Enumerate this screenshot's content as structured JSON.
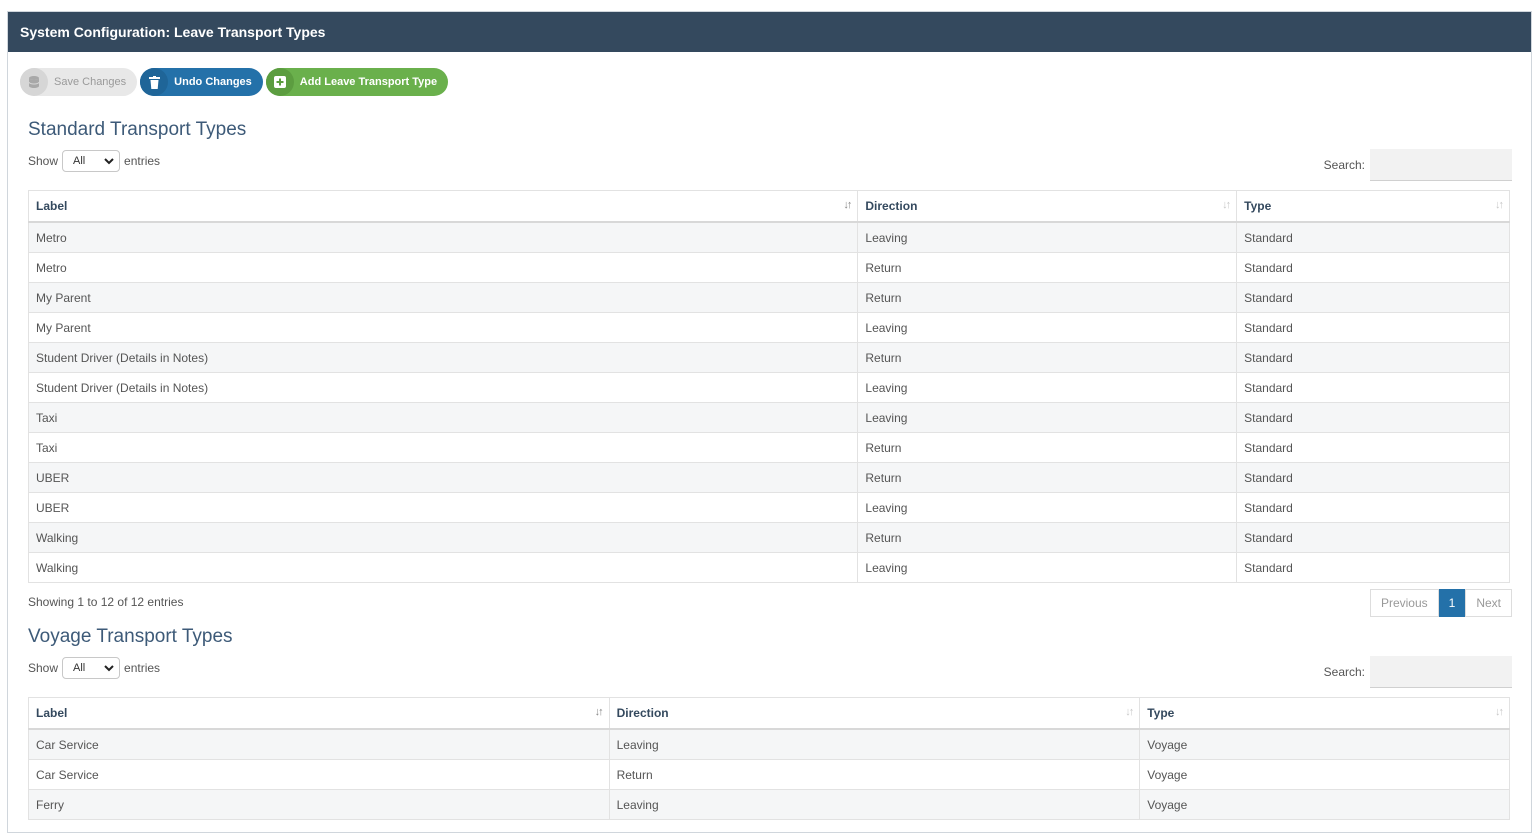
{
  "window": {
    "title": "System Configuration: Leave Transport Types"
  },
  "toolbar": {
    "save_label": "Save Changes",
    "undo_label": "Undo Changes",
    "add_label": "Add Leave Transport Type"
  },
  "standard": {
    "title": "Standard Transport Types",
    "show_label": "Show",
    "show_value": "All",
    "entries_label": "entries",
    "search_label": "Search:",
    "columns": {
      "label": "Label",
      "direction": "Direction",
      "type": "Type"
    },
    "rows": [
      [
        "Metro",
        "Leaving",
        "Standard"
      ],
      [
        "Metro",
        "Return",
        "Standard"
      ],
      [
        "My Parent",
        "Return",
        "Standard"
      ],
      [
        "My Parent",
        "Leaving",
        "Standard"
      ],
      [
        "Student Driver (Details in Notes)",
        "Return",
        "Standard"
      ],
      [
        "Student Driver (Details in Notes)",
        "Leaving",
        "Standard"
      ],
      [
        "Taxi",
        "Leaving",
        "Standard"
      ],
      [
        "Taxi",
        "Return",
        "Standard"
      ],
      [
        "UBER",
        "Return",
        "Standard"
      ],
      [
        "UBER",
        "Leaving",
        "Standard"
      ],
      [
        "Walking",
        "Return",
        "Standard"
      ],
      [
        "Walking",
        "Leaving",
        "Standard"
      ]
    ],
    "info": "Showing 1 to 12 of 12 entries",
    "pager": {
      "previous": "Previous",
      "current": "1",
      "next": "Next"
    }
  },
  "voyage": {
    "title": "Voyage Transport Types",
    "show_label": "Show",
    "show_value": "All",
    "entries_label": "entries",
    "search_label": "Search:",
    "columns": {
      "label": "Label",
      "direction": "Direction",
      "type": "Type"
    },
    "rows": [
      [
        "Car Service",
        "Leaving",
        "Voyage"
      ],
      [
        "Car Service",
        "Return",
        "Voyage"
      ],
      [
        "Ferry",
        "Leaving",
        "Voyage"
      ]
    ]
  },
  "colors": {
    "header_bar": "#34495e",
    "primary": "#2471a9",
    "success": "#6ab04c"
  },
  "icons": {
    "save": "database-icon",
    "undo": "trash-icon",
    "add": "plus-square-icon"
  }
}
